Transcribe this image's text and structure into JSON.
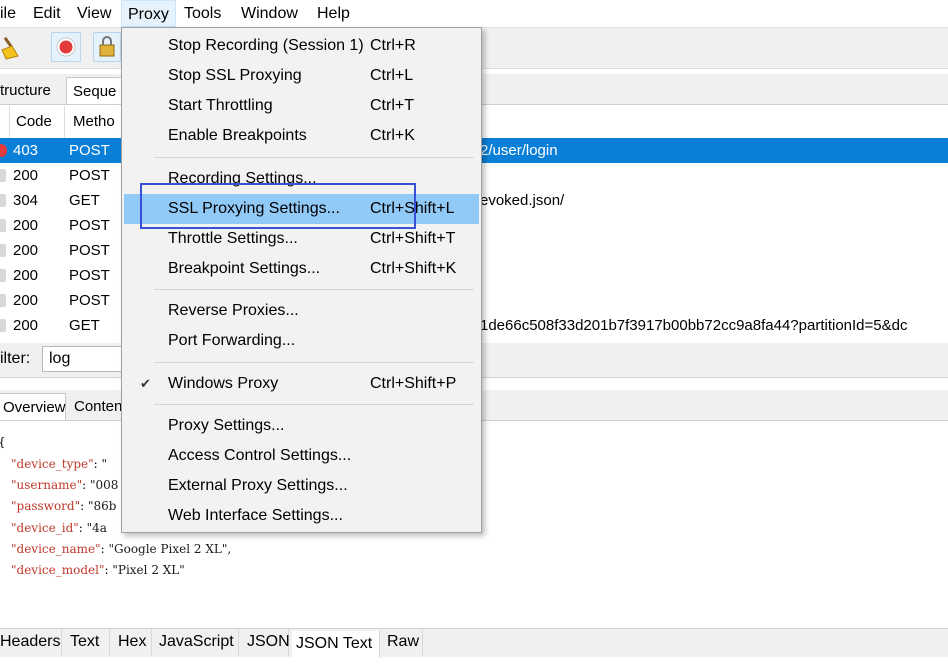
{
  "menubar": [
    "ile",
    "Edit",
    "View",
    "Proxy",
    "Tools",
    "Window",
    "Help"
  ],
  "view_tabs": [
    "tructure",
    "Seque"
  ],
  "table": {
    "headers": {
      "code": "Code",
      "method": "Metho"
    },
    "rows": [
      {
        "code": "403",
        "method": "POST",
        "path": "2/user/login",
        "selected": true
      },
      {
        "code": "200",
        "method": "POST",
        "path": ""
      },
      {
        "code": "304",
        "method": "GET",
        "path": "evoked.json/"
      },
      {
        "code": "200",
        "method": "POST",
        "path": ""
      },
      {
        "code": "200",
        "method": "POST",
        "path": ""
      },
      {
        "code": "200",
        "method": "POST",
        "path": ""
      },
      {
        "code": "200",
        "method": "POST",
        "path": ""
      },
      {
        "code": "200",
        "method": "GET",
        "path": "1de66c508f33d201b7f3917b00bb72cc9a8fa44?partitionId=5&dc"
      }
    ]
  },
  "filter": {
    "label": "ilter:",
    "value": "log"
  },
  "detail_tabs": [
    "Overview",
    "Conten"
  ],
  "json_view": {
    "open_brace": "{",
    "lines": [
      {
        "key": "\"device_type\"",
        "sep": ": ",
        "val": "\""
      },
      {
        "key": "\"username\"",
        "sep": ": ",
        "val": "\"008"
      },
      {
        "key": "\"password\"",
        "sep": ": ",
        "val": "\"86b"
      },
      {
        "key": "\"device_id\"",
        "sep": ": ",
        "val": "\"4a"
      },
      {
        "key": "\"device_name\"",
        "sep": ": ",
        "val": "\"Google Pixel 2 XL\","
      },
      {
        "key": "\"device_model\"",
        "sep": ": ",
        "val": "\"Pixel 2 XL\""
      }
    ]
  },
  "bottom_tabs": [
    "Headers",
    "Text",
    "Hex",
    "JavaScript",
    "JSON",
    "JSON Text",
    "Raw"
  ],
  "proxy_menu": {
    "items": [
      {
        "label": "Stop Recording (Session 1)",
        "shortcut": "Ctrl+R"
      },
      {
        "label": "Stop SSL Proxying",
        "shortcut": "Ctrl+L"
      },
      {
        "label": "Start Throttling",
        "shortcut": "Ctrl+T"
      },
      {
        "label": "Enable Breakpoints",
        "shortcut": "Ctrl+K"
      },
      {
        "label": "Recording Settings...",
        "shortcut": ""
      },
      {
        "label": "SSL Proxying Settings...",
        "shortcut": "Ctrl+Shift+L",
        "highlighted": true
      },
      {
        "label": "Throttle Settings...",
        "shortcut": "Ctrl+Shift+T"
      },
      {
        "label": "Breakpoint Settings...",
        "shortcut": "Ctrl+Shift+K"
      },
      {
        "label": "Reverse Proxies...",
        "shortcut": ""
      },
      {
        "label": "Port Forwarding...",
        "shortcut": ""
      },
      {
        "label": "Windows Proxy",
        "shortcut": "Ctrl+Shift+P",
        "checked": true
      },
      {
        "label": "Proxy Settings...",
        "shortcut": ""
      },
      {
        "label": "Access Control Settings...",
        "shortcut": ""
      },
      {
        "label": "External Proxy Settings...",
        "shortcut": ""
      },
      {
        "label": "Web Interface Settings...",
        "shortcut": ""
      }
    ]
  },
  "colors": {
    "selection": "#0a7fd8",
    "menu_highlight": "#91c9f7",
    "annotation_box": "#3a50d6",
    "record_button": "#e23b3b"
  },
  "icons": [
    "broom-icon",
    "record-icon",
    "lock-icon",
    "checkmark-icon"
  ]
}
